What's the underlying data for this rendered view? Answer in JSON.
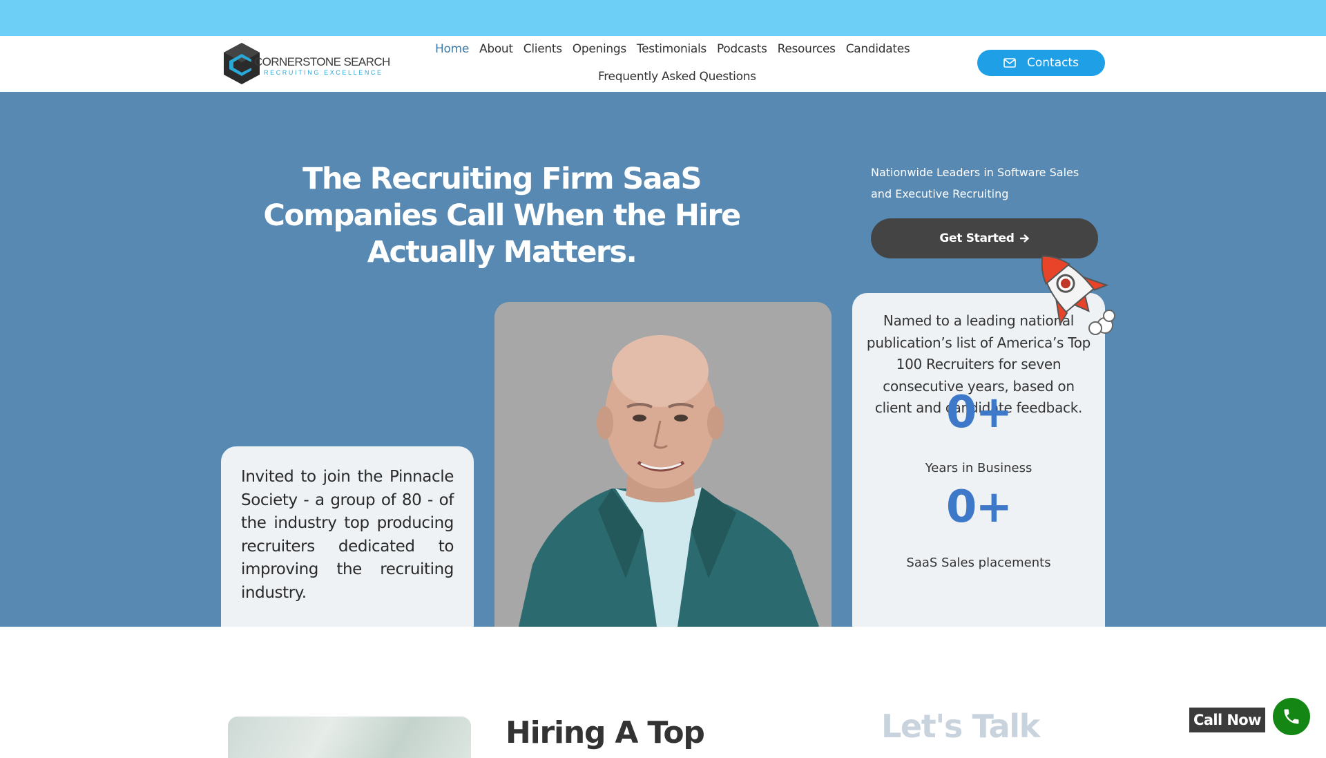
{
  "nav": {
    "logo_name": "CORNERSTONE SEARCH",
    "logo_tagline": "RECRUITING EXCELLENCE",
    "links": [
      "Home",
      "About",
      "Clients",
      "Openings",
      "Testimonials",
      "Podcasts",
      "Resources",
      "Candidates"
    ],
    "faq": "Frequently Asked Questions",
    "contacts_label": "Contacts",
    "active_link": "Home"
  },
  "hero": {
    "title": "The Recruiting Firm SaaS Companies Call When the Hire Actually Matters.",
    "tagline": "Nationwide Leaders in Software Sales and Executive Recruiting",
    "cta_label": "Get Started",
    "left_card_text": "Invited to join the Pinnacle Society - a group of 80 - of the industry top producing recruiters dedicated to improving the recruiting industry.",
    "right_card_quote": "Named to a leading national publication’s list of America’s Top 100 Recruiters for seven consecutive years, based on client and candidate feedback.",
    "stats": [
      {
        "value": "0+",
        "label": "Years in Business"
      },
      {
        "value": "0+",
        "label": "SaaS Sales placements"
      }
    ]
  },
  "lower": {
    "heading_partial": "Hiring A Top",
    "side_heading": "Let's Talk"
  },
  "floating": {
    "call_now_label": "Call Now"
  },
  "colors": {
    "topbar": "#6dcff6",
    "hero_bg": "#5789b3",
    "accent_blue": "#1f9fe5",
    "stat_blue": "#3d78c9",
    "call_green": "#138613"
  },
  "icons": {
    "contacts": "envelope-icon",
    "cta": "arrow-right-icon",
    "call": "phone-icon",
    "decor": "rocket-icon"
  }
}
